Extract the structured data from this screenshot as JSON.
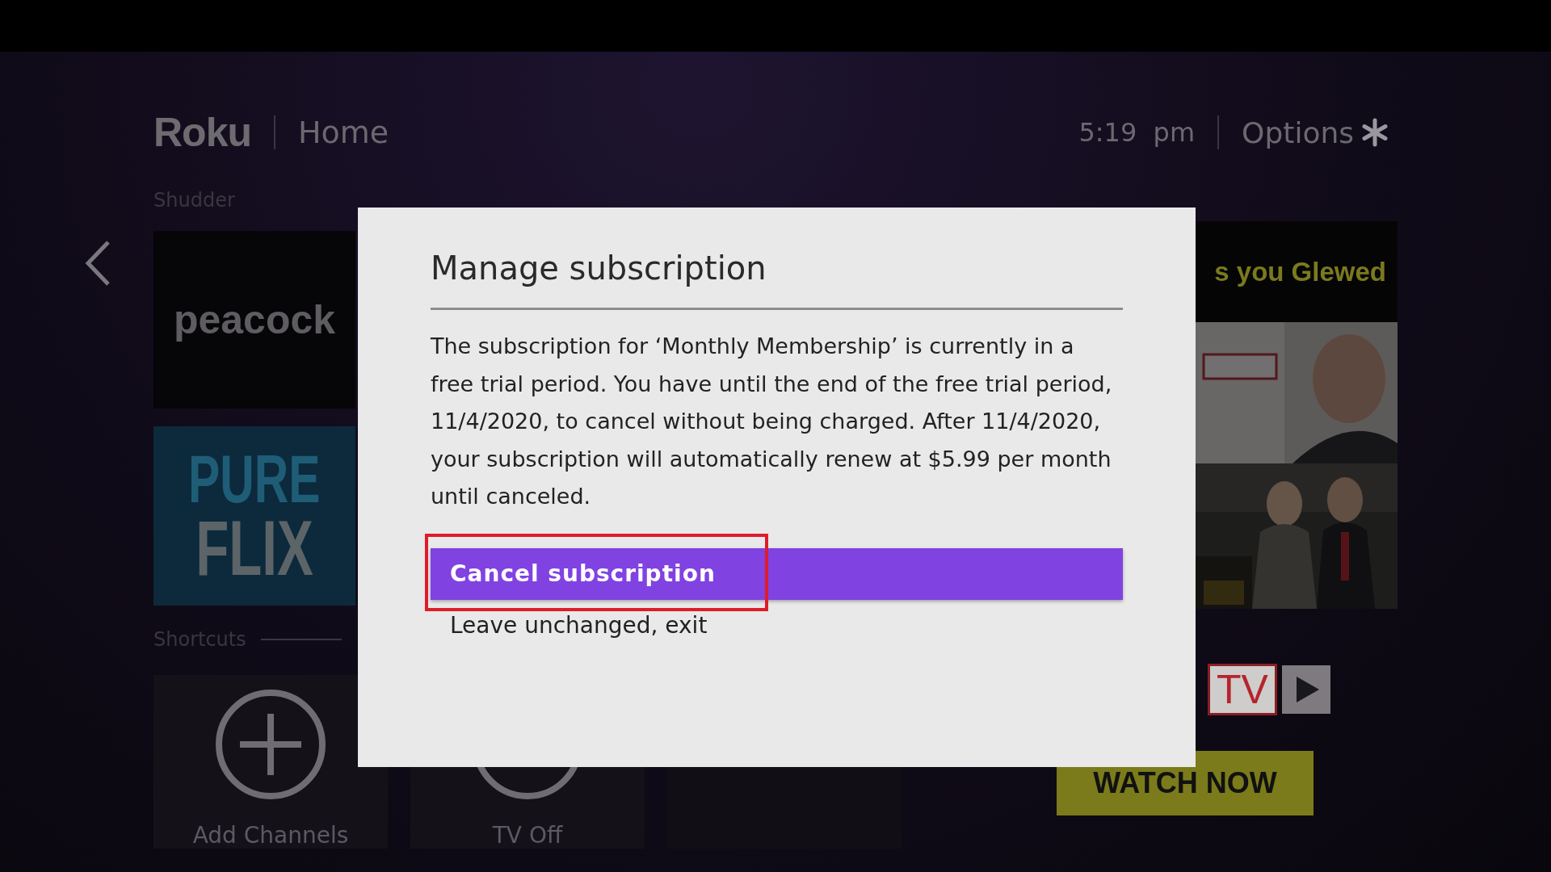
{
  "header": {
    "logo": "Roku",
    "section": "Home",
    "time": "5:19  pm",
    "options": "Options"
  },
  "channels": {
    "label": "Shudder",
    "tiles": [
      {
        "kind": "peacock",
        "lines": [
          "peacock"
        ]
      },
      {
        "kind": "pureflix",
        "lines": [
          "PURE",
          "FLIX"
        ]
      }
    ]
  },
  "shortcuts": {
    "label": "Shortcuts",
    "tiles": [
      {
        "kind": "add",
        "label": "Add Channels"
      },
      {
        "kind": "power",
        "label": "TV Off"
      }
    ]
  },
  "promo": {
    "headline": "s you Glewed",
    "logo_box": "TV",
    "button": "WATCH NOW"
  },
  "dialog": {
    "title": "Manage subscription",
    "body": "The subscription for ‘Monthly Membership’ is currently in a free trial period. You have until the end of the free trial period, 11/4/2020, to cancel without being charged. After 11/4/2020, your subscription will automatically renew at $5.99 per month until canceled.",
    "actions": [
      {
        "label": "Cancel subscription",
        "selected": true
      },
      {
        "label": "Leave unchanged, exit",
        "selected": false
      }
    ]
  }
}
